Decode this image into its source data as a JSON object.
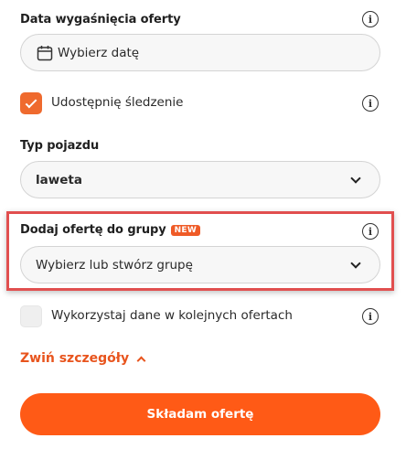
{
  "expiry": {
    "label": "Data wygaśnięcia oferty",
    "placeholder": "Wybierz datę",
    "icon": "calendar-icon"
  },
  "tracking": {
    "label": "Udostępnię śledzenie",
    "checked": true
  },
  "vehicle": {
    "label": "Typ pojazdu",
    "value": "laweta"
  },
  "group": {
    "label": "Dodaj ofertę do grupy",
    "badge": "NEW",
    "placeholder": "Wybierz lub stwórz grupę"
  },
  "reuse": {
    "label": "Wykorzystaj dane w kolejnych ofertach",
    "checked": false
  },
  "collapse": {
    "label": "Zwiń szczegóły"
  },
  "submit": {
    "label": "Składam ofertę"
  },
  "colors": {
    "accent": "#ff5a16",
    "highlight_border": "#e14f4f"
  }
}
